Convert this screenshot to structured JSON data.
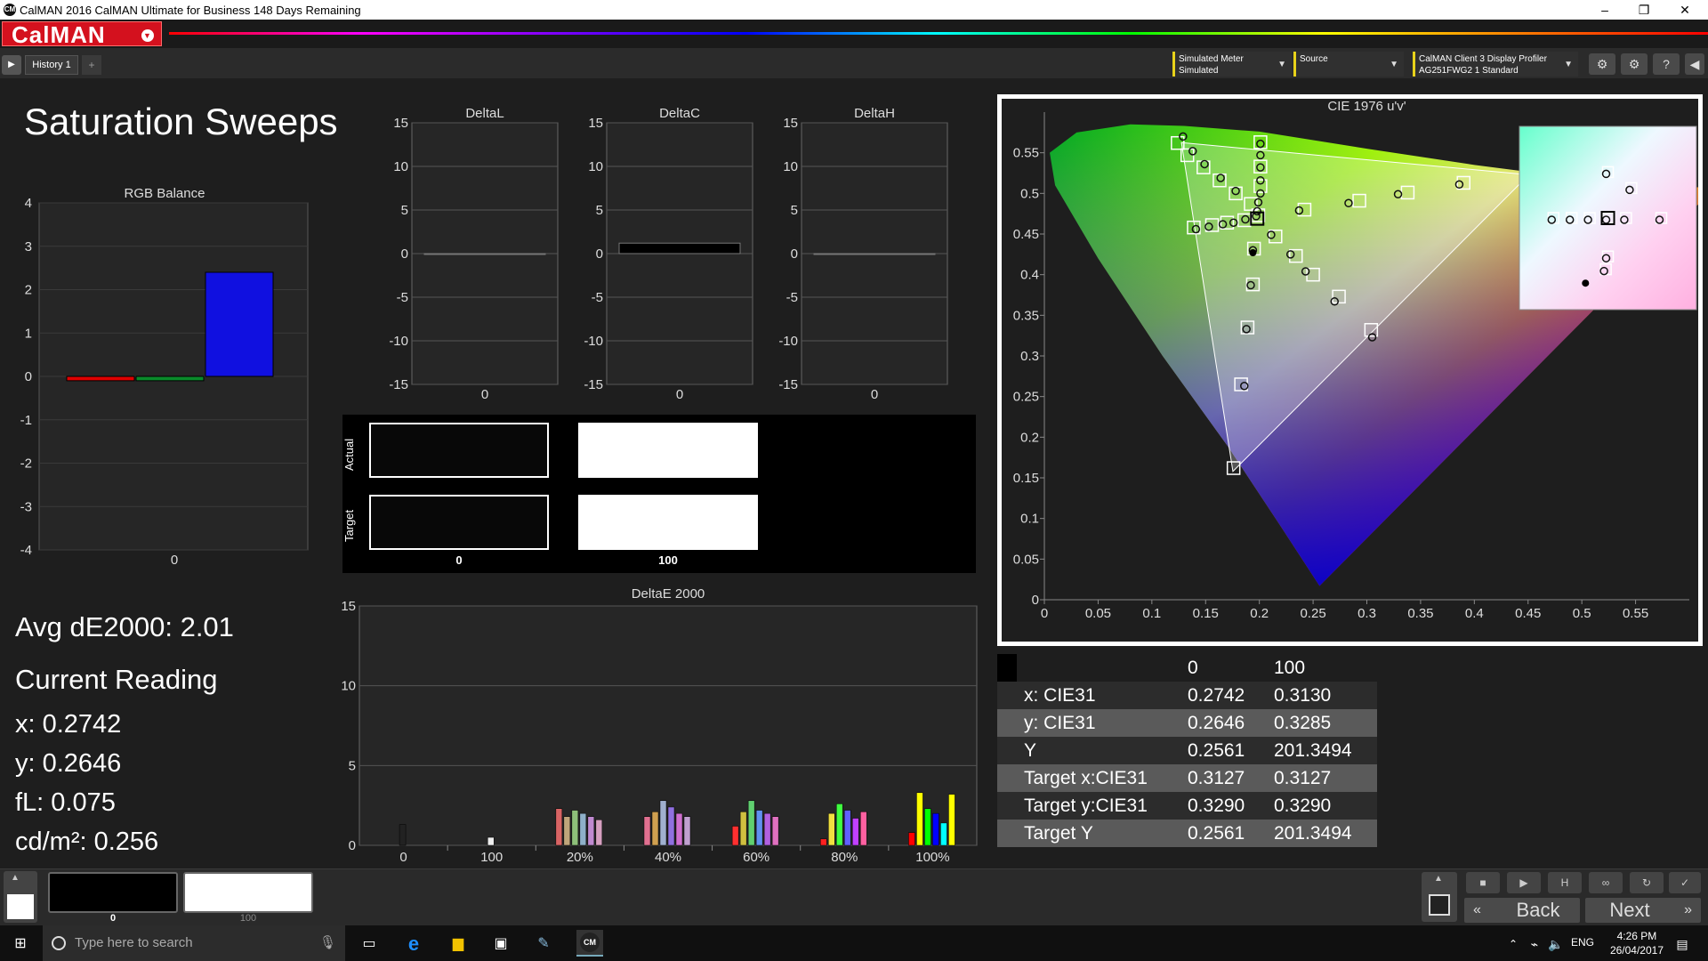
{
  "window": {
    "title": "CalMAN 2016 CalMAN Ultimate for Business 148 Days Remaining",
    "minimize": "–",
    "restore": "❐",
    "close": "✕"
  },
  "app": {
    "logo": "CalMAN",
    "history_tab": "History 1",
    "add_tab": "+"
  },
  "devices": {
    "meter_line1": "Simulated Meter",
    "meter_line2": "Simulated",
    "source_line1": "Source",
    "display_line1": "CalMAN Client 3 Display Profiler",
    "display_line2": "AG251FWG2 1 Standard"
  },
  "page": {
    "title": "Saturation Sweeps"
  },
  "reading": {
    "avg": "Avg dE2000: 2.01",
    "current": "Current Reading",
    "x": "x: 0.2742",
    "y": "y: 0.2646",
    "fl": "fL: 0.075",
    "cdm2": "cd/m²: 0.256"
  },
  "swatch": {
    "actual_label": "Actual",
    "target_label": "Target",
    "label0": "0",
    "label100": "100"
  },
  "table": {
    "headers": [
      "",
      "0",
      "100"
    ],
    "rows": [
      [
        "x: CIE31",
        "0.2742",
        "0.3130"
      ],
      [
        "y: CIE31",
        "0.2646",
        "0.3285"
      ],
      [
        "Y",
        "0.2561",
        "201.3494"
      ],
      [
        "Target x:CIE31",
        "0.3127",
        "0.3127"
      ],
      [
        "Target y:CIE31",
        "0.3290",
        "0.3290"
      ],
      [
        "Target Y",
        "0.2561",
        "201.3494"
      ]
    ]
  },
  "nav": {
    "back": "Back",
    "next": "Next",
    "chip0": "0",
    "chip100": "100"
  },
  "taskbar": {
    "search_placeholder": "Type here to search",
    "lang": "ENG",
    "time": "4:26 PM",
    "date": "26/04/2017"
  },
  "colors": {
    "accent": "#d4111e",
    "meter_accent": "#e8d21a",
    "red": "#e00000",
    "green": "#0a8a2a",
    "blue": "#1010e0"
  },
  "chart_data": [
    {
      "type": "bar",
      "title": "RGB Balance",
      "categories": [
        "0"
      ],
      "series": [
        {
          "values": [
            -0.1
          ]
        },
        {
          "values": [
            -0.1
          ]
        },
        {
          "values": [
            2.4
          ]
        }
      ],
      "ylim": [
        -4,
        4
      ],
      "yticks": [
        4,
        3,
        2,
        1,
        0,
        -1,
        -2,
        -3,
        -4
      ]
    },
    {
      "type": "bar",
      "title": "DeltaL",
      "categories": [
        "0"
      ],
      "values": [
        0.0
      ],
      "ylim": [
        -15,
        15
      ],
      "yticks": [
        15,
        10,
        5,
        0,
        -5,
        -10,
        -15
      ]
    },
    {
      "type": "bar",
      "title": "DeltaC",
      "categories": [
        "0"
      ],
      "values": [
        1.2
      ],
      "ylim": [
        -15,
        15
      ],
      "yticks": [
        15,
        10,
        5,
        0,
        -5,
        -10,
        -15
      ]
    },
    {
      "type": "bar",
      "title": "DeltaH",
      "categories": [
        "0"
      ],
      "values": [
        0.0
      ],
      "ylim": [
        -15,
        15
      ],
      "yticks": [
        15,
        10,
        5,
        0,
        -5,
        -10,
        -15
      ]
    },
    {
      "type": "bar",
      "title": "DeltaE 2000",
      "categories": [
        "0",
        "100",
        "20%",
        "40%",
        "60%",
        "80%",
        "100%"
      ],
      "values": [
        [
          1.3
        ],
        [
          0.5
        ],
        [
          2.3,
          1.8,
          2.2,
          2.0,
          1.8,
          1.6
        ],
        [
          1.8,
          2.1,
          2.8,
          2.4,
          2.0,
          1.8
        ],
        [
          1.2,
          2.1,
          2.8,
          2.2,
          2.0,
          1.8
        ],
        [
          0.4,
          2.0,
          2.6,
          2.2,
          1.7,
          2.1
        ],
        [
          0.8,
          3.3,
          2.3,
          2.0,
          1.4,
          3.2
        ]
      ],
      "ylim": [
        0,
        15
      ],
      "yticks": [
        15,
        10,
        5,
        0
      ]
    },
    {
      "type": "scatter",
      "title": "CIE 1976 u'v'",
      "xlim": [
        0,
        0.6
      ],
      "ylim": [
        0,
        0.6
      ],
      "xticks": [
        0,
        0.05,
        0.1,
        0.15,
        0.2,
        0.25,
        0.3,
        0.35,
        0.4,
        0.45,
        0.5,
        0.55
      ],
      "yticks": [
        0,
        0.05,
        0.1,
        0.15,
        0.2,
        0.25,
        0.3,
        0.35,
        0.4,
        0.45,
        0.5,
        0.55
      ],
      "targets": [
        [
          0.124,
          0.562
        ],
        [
          0.133,
          0.547
        ],
        [
          0.148,
          0.532
        ],
        [
          0.163,
          0.516
        ],
        [
          0.178,
          0.5
        ],
        [
          0.192,
          0.487
        ],
        [
          0.199,
          0.473
        ],
        [
          0.139,
          0.458
        ],
        [
          0.156,
          0.461
        ],
        [
          0.17,
          0.464
        ],
        [
          0.186,
          0.467
        ],
        [
          0.195,
          0.432
        ],
        [
          0.194,
          0.388
        ],
        [
          0.189,
          0.335
        ],
        [
          0.183,
          0.265
        ],
        [
          0.176,
          0.162
        ],
        [
          0.215,
          0.447
        ],
        [
          0.234,
          0.423
        ],
        [
          0.25,
          0.4
        ],
        [
          0.274,
          0.373
        ],
        [
          0.304,
          0.332
        ],
        [
          0.242,
          0.48
        ],
        [
          0.293,
          0.491
        ],
        [
          0.338,
          0.501
        ],
        [
          0.39,
          0.513
        ],
        [
          0.201,
          0.563
        ],
        [
          0.201,
          0.533
        ],
        [
          0.201,
          0.509
        ]
      ],
      "measured": [
        [
          0.129,
          0.57
        ],
        [
          0.138,
          0.552
        ],
        [
          0.149,
          0.536
        ],
        [
          0.164,
          0.519
        ],
        [
          0.178,
          0.503
        ],
        [
          0.199,
          0.489
        ],
        [
          0.198,
          0.478
        ],
        [
          0.197,
          0.472
        ],
        [
          0.141,
          0.456
        ],
        [
          0.153,
          0.459
        ],
        [
          0.166,
          0.462
        ],
        [
          0.176,
          0.464
        ],
        [
          0.187,
          0.468
        ],
        [
          0.194,
          0.43
        ],
        [
          0.192,
          0.387
        ],
        [
          0.188,
          0.333
        ],
        [
          0.186,
          0.263
        ],
        [
          0.211,
          0.449
        ],
        [
          0.229,
          0.425
        ],
        [
          0.243,
          0.404
        ],
        [
          0.27,
          0.367
        ],
        [
          0.305,
          0.323
        ],
        [
          0.237,
          0.479
        ],
        [
          0.283,
          0.488
        ],
        [
          0.329,
          0.499
        ],
        [
          0.386,
          0.511
        ],
        [
          0.201,
          0.561
        ],
        [
          0.201,
          0.547
        ],
        [
          0.201,
          0.532
        ],
        [
          0.201,
          0.516
        ],
        [
          0.201,
          0.5
        ]
      ],
      "current": [
        0.194,
        0.427
      ]
    }
  ]
}
